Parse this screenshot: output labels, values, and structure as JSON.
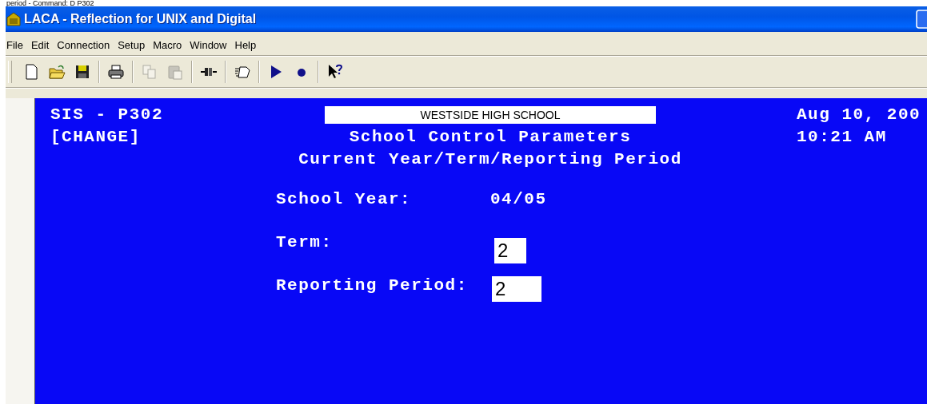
{
  "caption": "period - Command: D P302",
  "window": {
    "title": "LACA - Reflection for UNIX and Digital"
  },
  "menu": [
    "File",
    "Edit",
    "Connection",
    "Setup",
    "Macro",
    "Window",
    "Help"
  ],
  "toolbar": [
    {
      "kind": "new",
      "disabled": false
    },
    {
      "kind": "open",
      "disabled": false
    },
    {
      "kind": "save",
      "disabled": false
    },
    {
      "kind": "sep"
    },
    {
      "kind": "print",
      "disabled": false
    },
    {
      "kind": "sep"
    },
    {
      "kind": "copy",
      "disabled": true
    },
    {
      "kind": "paste",
      "disabled": true
    },
    {
      "kind": "sep"
    },
    {
      "kind": "connect",
      "disabled": false
    },
    {
      "kind": "sep"
    },
    {
      "kind": "macro",
      "disabled": false
    },
    {
      "kind": "sep"
    },
    {
      "kind": "play",
      "disabled": false
    },
    {
      "kind": "record",
      "disabled": false
    },
    {
      "kind": "sep"
    },
    {
      "kind": "help",
      "disabled": false
    }
  ],
  "terminal": {
    "header_left": [
      "SIS - P302",
      "[CHANGE]"
    ],
    "school": "WESTSIDE HIGH SCHOOL",
    "titles": [
      "School Control Parameters",
      "Current Year/Term/Reporting Period"
    ],
    "header_right": [
      "Aug 10, 200",
      "10:21 AM"
    ],
    "fields": [
      {
        "label": "School Year:",
        "value": "04/05",
        "kind": "text"
      },
      {
        "label": "Term:",
        "value": "2",
        "kind": "input"
      },
      {
        "label": "Reporting Period:",
        "value": "2",
        "kind": "input"
      }
    ]
  }
}
